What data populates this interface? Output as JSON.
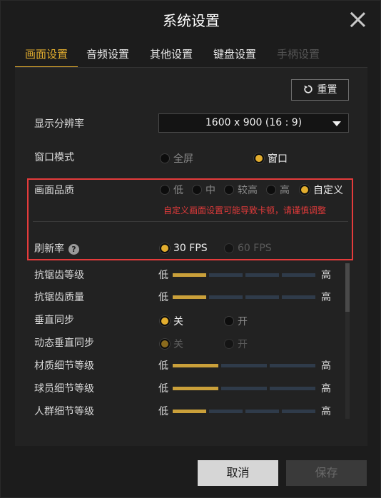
{
  "window": {
    "title": "系统设置"
  },
  "tabs": [
    {
      "label": "画面设置",
      "state": "active"
    },
    {
      "label": "音频设置",
      "state": "normal"
    },
    {
      "label": "其他设置",
      "state": "normal"
    },
    {
      "label": "键盘设置",
      "state": "normal"
    },
    {
      "label": "手柄设置",
      "state": "disabled"
    }
  ],
  "reset_label": "重置",
  "settings": {
    "resolution": {
      "label": "显示分辨率",
      "value": "1600 x 900 (16 : 9)"
    },
    "window_mode": {
      "label": "窗口模式",
      "options": [
        "全屏",
        "窗口"
      ],
      "selected": "窗口"
    },
    "quality": {
      "label": "画面品质",
      "options": [
        "低",
        "中",
        "较高",
        "高",
        "自定义"
      ],
      "selected": "自定义",
      "warning": "自定义画面设置可能导致卡顿，请谨慎调整"
    },
    "refresh_rate": {
      "label": "刷新率",
      "help": "?",
      "options": [
        "30 FPS",
        "60 FPS"
      ],
      "selected": "30 FPS"
    },
    "aa_level": {
      "label": "抗锯齿等级",
      "low": "低",
      "high": "高",
      "level": 1,
      "steps": 4
    },
    "aa_quality": {
      "label": "抗锯齿质量",
      "low": "低",
      "high": "高",
      "level": 1,
      "steps": 4
    },
    "vsync": {
      "label": "垂直同步",
      "options": [
        "关",
        "开"
      ],
      "selected": "关"
    },
    "adaptive_vsync": {
      "label": "动态垂直同步",
      "options": [
        "关",
        "开"
      ],
      "selected": "关",
      "disabled": true
    },
    "texture_detail": {
      "label": "材质细节等级",
      "low": "低",
      "high": "高",
      "level": 1,
      "steps": 3
    },
    "player_detail": {
      "label": "球员细节等级",
      "low": "低",
      "high": "高",
      "level": 1,
      "steps": 3
    },
    "crowd_detail": {
      "label": "人群细节等级",
      "low": "低",
      "high": "高",
      "level": 1,
      "steps": 4
    }
  },
  "buttons": {
    "cancel": "取消",
    "save": "保存"
  },
  "colors": {
    "accent": "#e2ad2e",
    "warning": "#e03a3a",
    "highlight_border": "#e53b3b"
  }
}
